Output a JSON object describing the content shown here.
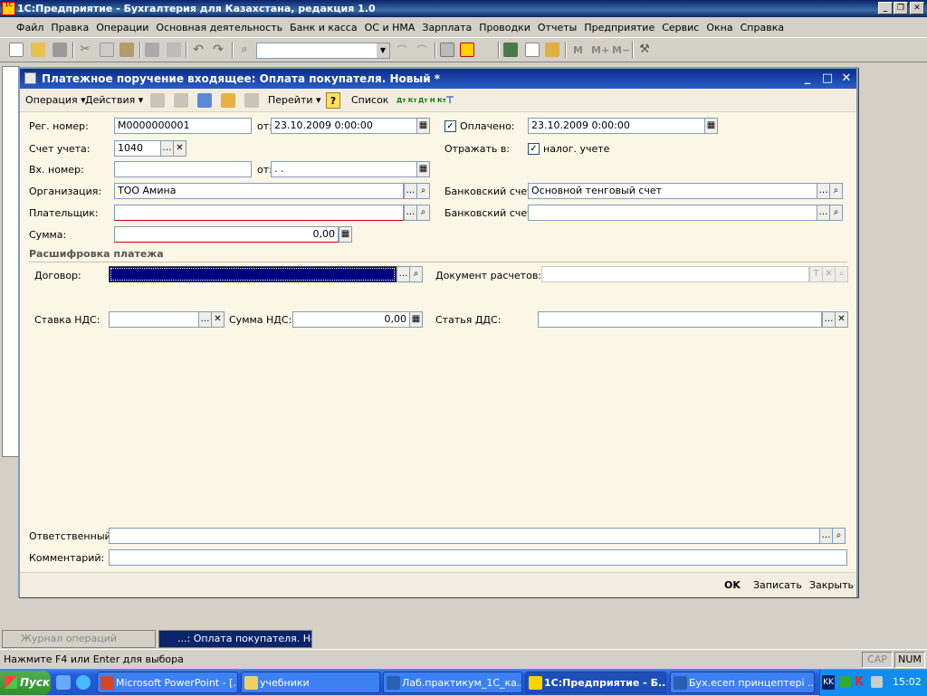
{
  "app": {
    "title": "1С:Предприятие - Бухгалтерия для Казахстана, редакция 1.0",
    "icon_text": "1С"
  },
  "menu": [
    "Файл",
    "Правка",
    "Операции",
    "Основная деятельность",
    "Банк и касса",
    "ОС и НМА",
    "Зарплата",
    "Проводки",
    "Отчеты",
    "Предприятие",
    "Сервис",
    "Окна",
    "Справка"
  ],
  "toolbar": {
    "icons": [
      "new-icon",
      "open-icon",
      "save-icon",
      "cut-icon",
      "copy-icon",
      "paste-icon",
      "print-icon",
      "preview-icon",
      "undo-icon",
      "redo-icon",
      "find-icon",
      "search-combo",
      "find-next-icon",
      "find-prev-icon",
      "window-icon",
      "1c-help-icon",
      "calculator-icon",
      "calendar-icon",
      "user-icon",
      "m-icon",
      "m-plus-icon",
      "m-minus-icon",
      "tools-icon"
    ],
    "memory": [
      "M",
      "M+",
      "M−"
    ]
  },
  "dialog": {
    "title": "Платежное поручение входящее: Оплата покупателя. Новый *",
    "toolbar": {
      "operation": "Операция",
      "actions": "Действия",
      "goto": "Перейти",
      "help": "?",
      "list": "Список",
      "dt_kt": "Дт Кт",
      "dt_kt_n": "Дт Н Кт"
    },
    "form": {
      "reg_label": "Рег. номер:",
      "reg_value": "М0000000001",
      "from_label": "от:",
      "reg_date": "23.10.2009  0:00:00",
      "paid_label": "Оплачено:",
      "paid_checked": true,
      "paid_date": "23.10.2009  0:00:00",
      "account_label": "Счет учета:",
      "account_value": "1040",
      "reflect_label": "Отражать в:",
      "tax_label": "налог. учете",
      "tax_checked": true,
      "in_label": "Вх. номер:",
      "in_value": "",
      "in_date": "  .  .",
      "org_label": "Организация:",
      "org_value": "ТОО Амина",
      "bank_label": "Банковский счет:",
      "bank_value": "Основной тенговый счет",
      "payer_label": "Плательщик:",
      "payer_value": "",
      "bank2_label": "Банковский счет:",
      "bank2_value": "",
      "sum_label": "Сумма:",
      "sum_value": "0,00",
      "section_label": "Расшифровка платежа",
      "contract_label": "Договор:",
      "doc_label": "Документ расчетов:",
      "vat_rate_label": "Ставка НДС:",
      "vat_sum_label": "Сумма НДС:",
      "vat_sum_value": "0,00",
      "dds_label": "Статья ДДС:",
      "resp_label": "Ответственный:",
      "comment_label": "Комментарий:"
    },
    "footer": {
      "ok": "OK",
      "write": "Записать",
      "close": "Закрыть"
    }
  },
  "window_tabs": [
    {
      "label": "Журнал операций",
      "active": false
    },
    {
      "label": "...: Оплата покупателя. Нов...",
      "active": true
    }
  ],
  "status": {
    "hint": "Нажмите F4 или Enter для выбора",
    "cap": "CAP",
    "num": "NUM"
  },
  "taskbar": {
    "start": "Пуск",
    "tasks": [
      {
        "label": "Microsoft PowerPoint - [...",
        "active": false
      },
      {
        "label": "учебники",
        "active": false
      },
      {
        "label": "Лаб.практикум_1С_ка...",
        "active": false
      },
      {
        "label": "1С:Предприятие - Б...",
        "active": true
      },
      {
        "label": "Бух.есеп принцептері ...",
        "active": false
      }
    ],
    "lang": "KK",
    "time": "15:02"
  },
  "colors": {
    "accent": "#0a246a",
    "dialog_bg": "#fbf6e6",
    "selection": "#000080",
    "taskbar": "#245edb"
  }
}
